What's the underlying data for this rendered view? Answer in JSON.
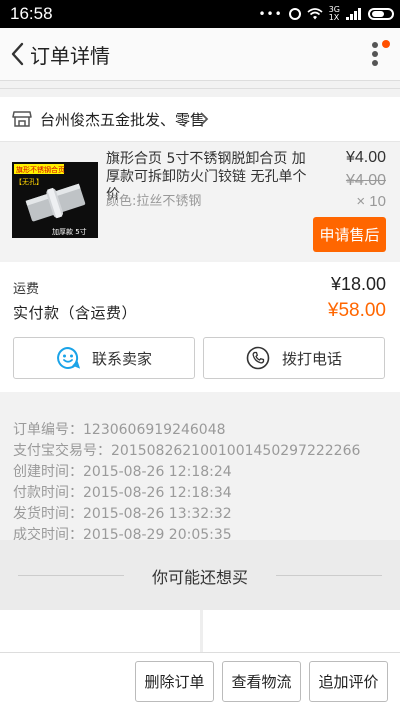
{
  "status_bar": {
    "time": "16:58",
    "network_top": "3G",
    "network_bottom": "1X",
    "icons": [
      "dots-icon",
      "alarm-icon",
      "wifi-icon",
      "signal-icon",
      "battery-icon"
    ]
  },
  "header": {
    "title": "订单详情",
    "accent_color": "#ff5000"
  },
  "shop": {
    "name": "台州俊杰五金批发、零售"
  },
  "item": {
    "title": "旗形合页 5寸不锈钢脱卸合页 加厚款可拆卸防火门铰链 无孔单个价",
    "spec": "颜色:拉丝不锈钢",
    "price": "¥4.00",
    "original_price": "¥4.00",
    "quantity": "× 10",
    "after_sale_label": "申请售后",
    "image_text": {
      "top_banner": "旗形不锈钢合页",
      "tag": "【无孔】",
      "bottom": "加厚款  5寸"
    }
  },
  "summary": {
    "shipping_label": "运费",
    "shipping_value": "¥18.00",
    "paid_label": "实付款（含运费）",
    "paid_value": "¥58.00",
    "contact_seller_label": "联系卖家",
    "call_label": "拨打电话"
  },
  "order_info": {
    "lines": [
      "订单编号：1230606919246048",
      "支付宝交易号：2015082621001001450297222266",
      "创建时间：2015-08-26 12:18:24",
      "付款时间：2015-08-26 12:18:34",
      "发货时间：2015-08-26 13:32:32",
      "成交时间：2015-08-29 20:05:35"
    ]
  },
  "recommend": {
    "title": "你可能还想买"
  },
  "bottom_bar": {
    "delete_label": "删除订单",
    "logistics_label": "查看物流",
    "review_label": "追加评价"
  },
  "colors": {
    "orange": "#ff6600",
    "blue_icon": "#1aa3e8"
  }
}
